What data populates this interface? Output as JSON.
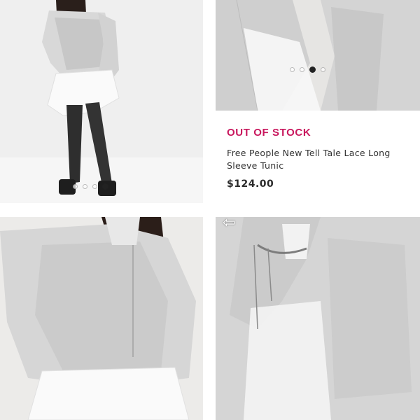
{
  "product": {
    "stock_status": "OUT OF STOCK",
    "name": "Free People New Tell Tale Lace Long Sleeve Tunic",
    "price": "$124.00"
  },
  "colors": {
    "stock_accent": "#c8175d",
    "text_primary": "#333333"
  },
  "gallery": {
    "main_carousel": {
      "count": 4,
      "active_index": 3
    },
    "detail_carousel": {
      "count": 4,
      "active_index": 2
    }
  },
  "icons": {
    "back": "back-arrow-icon"
  },
  "arrow_glyph": "⇦"
}
